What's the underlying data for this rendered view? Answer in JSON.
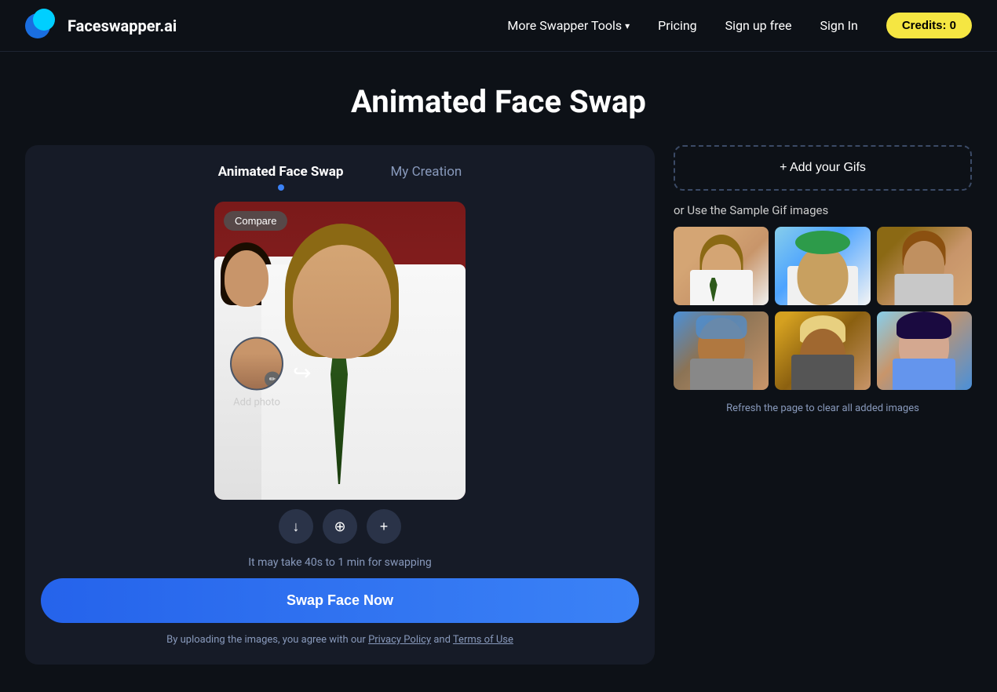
{
  "header": {
    "logo_text": "Faceswapper.ai",
    "nav": {
      "tools_label": "More Swapper Tools",
      "pricing_label": "Pricing",
      "signup_label": "Sign up free",
      "signin_label": "Sign In",
      "credits_label": "Credits: 0"
    }
  },
  "page": {
    "title": "Animated Face Swap"
  },
  "tabs": {
    "tab1_label": "Animated Face Swap",
    "tab2_label": "My Creation"
  },
  "preview": {
    "compare_btn": "Compare",
    "add_photo_label": "Add photo",
    "timing_note": "It may take 40s to 1 min for swapping",
    "swap_btn": "Swap Face Now",
    "legal_text": "By uploading the images, you agree with our",
    "privacy_label": "Privacy Policy",
    "and_label": "and",
    "terms_label": "Terms of Use"
  },
  "right_panel": {
    "add_gif_label": "+ Add your Gifs",
    "sample_label": "or Use the Sample Gif images",
    "refresh_note": "Refresh the page to clear all added images"
  },
  "icons": {
    "download": "↓",
    "zoom": "⊕",
    "plus": "+",
    "chevron_down": "▾",
    "pencil": "✏"
  }
}
